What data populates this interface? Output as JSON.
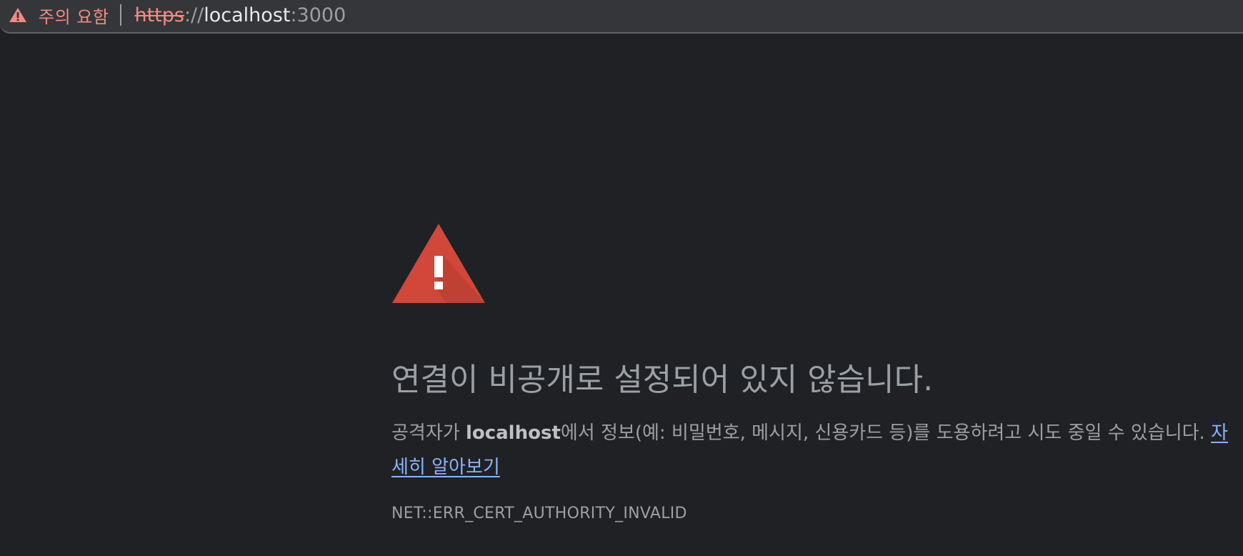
{
  "omnibox": {
    "security_label": "주의 요함",
    "url_scheme": "https",
    "url_separator": "://",
    "url_host": "localhost",
    "url_port": ":3000",
    "colors": {
      "warning": "#f28b82",
      "background": "#35363a"
    },
    "icon": "warning-triangle-icon"
  },
  "interstitial": {
    "icon": "danger-triangle-icon",
    "icon_color": "#d1473a",
    "heading": "연결이 비공개로 설정되어 있지 않습니다.",
    "description_prefix": "공격자가 ",
    "description_host": "localhost",
    "description_suffix": "에서 정보(예: 비밀번호, 메시지, 신용카드 등)를 도용하려고 시도 중일 수 있습니다. ",
    "learn_more_link": "자세히 알아보기",
    "error_code": "NET::ERR_CERT_AUTHORITY_INVALID",
    "link_color": "#8ab4f8"
  }
}
